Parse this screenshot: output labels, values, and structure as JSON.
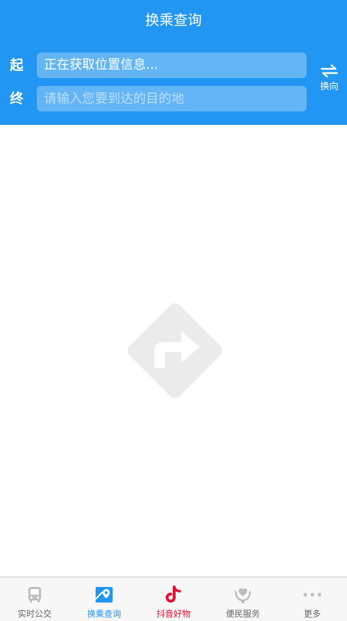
{
  "header": {
    "title": "换乘查询",
    "start_label": "起",
    "start_value": "正在获取位置信息...",
    "end_label": "终",
    "end_placeholder": "请输入您要到达的目的地",
    "swap_label": "换向"
  },
  "empty_state": {
    "icon": "route-sign-icon"
  },
  "tabbar": {
    "items": [
      {
        "label": "实时公交",
        "icon": "bus-icon",
        "active": false
      },
      {
        "label": "换乘查询",
        "icon": "map-pin-icon",
        "active": true
      },
      {
        "label": "抖音好物",
        "icon": "douyin-icon",
        "active": false
      },
      {
        "label": "便民服务",
        "icon": "heart-hand-icon",
        "active": false
      },
      {
        "label": "更多",
        "icon": "more-dots-icon",
        "active": false
      }
    ]
  },
  "colors": {
    "primary": "#2196f3",
    "field_bg": "#64b5f6",
    "douyin_red": "#e8112d",
    "inactive_icon": "#bdbdbd"
  }
}
